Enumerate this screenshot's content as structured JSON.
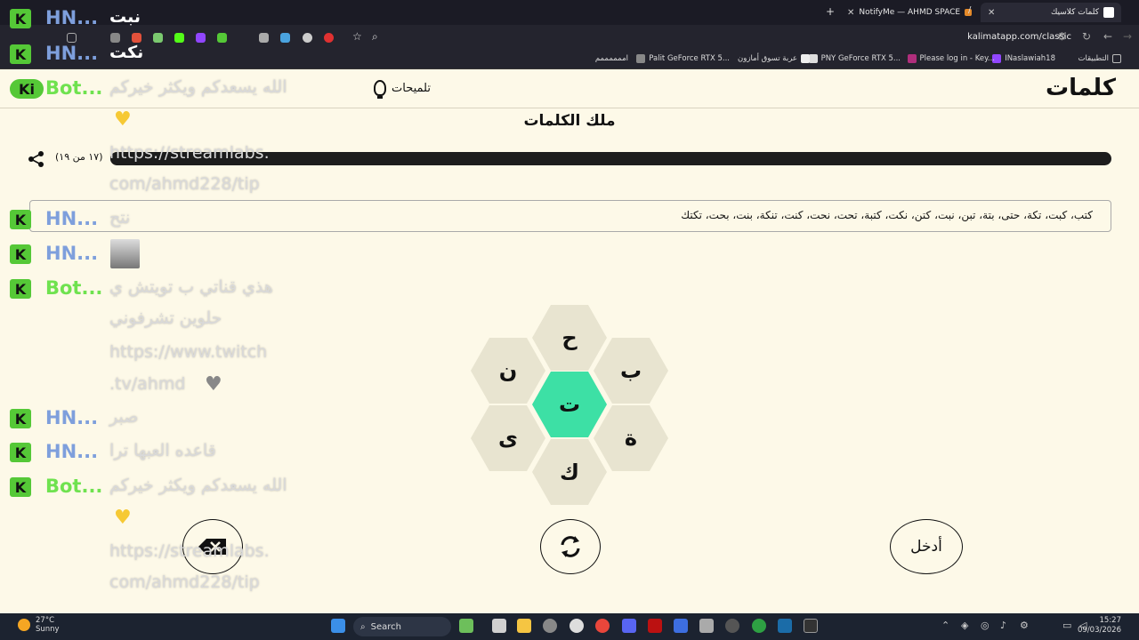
{
  "browser": {
    "tabs": [
      {
        "label": "NotifyMe — AHMD SPACE"
      },
      {
        "label": "كلمات كلاسيك"
      }
    ],
    "url": "kalimatapp.com/classic",
    "bookmarks": [
      "التطبيقات",
      "INaslawiah18",
      "Please log in - Key...",
      "PNY GeForce RTX 5...",
      "عربة تسوق أمازون",
      "Palit GeForce RTX 5...",
      "اممممممم"
    ]
  },
  "site": {
    "logo": "كلمات",
    "hints_label": "تلميحات",
    "level_title": "ملك الكلمات",
    "progress_text": "(١٧ من ١٩)",
    "progress_fraction": 0.895,
    "found_words": "كتب، كبت، تكة، حتى، بتة، تبن، نبت، كتن، نكت، كتبة، تحت، نحت، كنت، تنكة، بنت، بحت، تكتك",
    "letters": {
      "top": "ح",
      "top_right": "ب",
      "bottom_right": "ة",
      "bottom": "ك",
      "bottom_left": "ى",
      "top_left": "ن",
      "center": "ت"
    },
    "enter_label": "أدخل",
    "center_color": "#3de0a5"
  },
  "chat": {
    "rows": [
      {
        "badge": "K",
        "user": "HN...",
        "msg": "نبت"
      },
      {
        "badge": "K",
        "user": "HN...",
        "msg": "نكت"
      },
      {
        "badge": "Ki",
        "user": "Bot...",
        "msg": "الله يسعدكم ويكثر خيركم"
      },
      {
        "line": "https://streamlabs."
      },
      {
        "line": "com/ahmd228/tip"
      },
      {
        "badge": "K",
        "user": "HN...",
        "msg": "نتح"
      },
      {
        "badge": "K",
        "user": "HN..."
      },
      {
        "badge": "K",
        "user": "Bot...",
        "msg": "هذي قناتي ب تويتش ي"
      },
      {
        "line": "حلوين تشرفوني"
      },
      {
        "line": "https://www.twitch"
      },
      {
        "line": ".tv/ahmd"
      },
      {
        "badge": "K",
        "user": "HN...",
        "msg": "صبر"
      },
      {
        "badge": "K",
        "user": "HN...",
        "msg": "قاعده العبها ترا"
      },
      {
        "badge": "K",
        "user": "Bot...",
        "msg": "الله يسعدكم ويكثر خيركم"
      },
      {
        "line": "https://streamlabs."
      },
      {
        "line": "com/ahmd228/tip"
      }
    ]
  },
  "taskbar": {
    "weather_temp": "27°C",
    "weather_desc": "Sunny",
    "search_label": "Search",
    "time": "15:27",
    "date": "09/03/2026"
  }
}
